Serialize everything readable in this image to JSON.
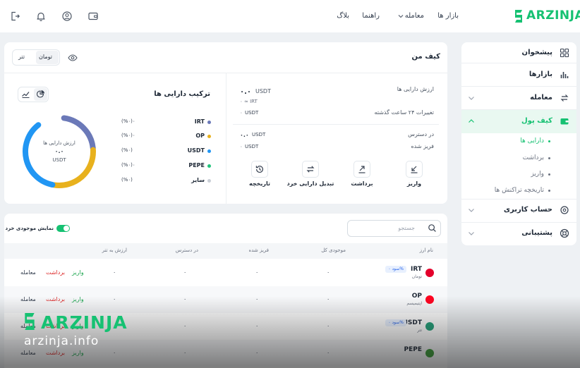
{
  "brand": {
    "name": "ARZINJA",
    "accent": "#16c172"
  },
  "header": {
    "nav": {
      "markets": "بازار ها",
      "trade": "معامله",
      "guide": "راهنما",
      "blog": "بلاگ"
    },
    "icons": [
      "wallet-icon",
      "user-icon",
      "bell-icon",
      "logout-icon"
    ]
  },
  "sidebar": {
    "items": [
      {
        "label": "پیشخوان",
        "icon": "grid-icon"
      },
      {
        "label": "بازارها",
        "icon": "bar-chart-icon"
      },
      {
        "label": "معامله",
        "icon": "exchange-icon"
      },
      {
        "label": "کیف پول",
        "icon": "wallet-icon"
      },
      {
        "label": "حساب کاربری",
        "icon": "settings-icon"
      },
      {
        "label": "پشتیبانی",
        "icon": "support-icon"
      }
    ],
    "wallet_sub": [
      "دارایی ها",
      "برداشت",
      "واریز",
      "تاریخچه تراکنش ها"
    ]
  },
  "wallet": {
    "title": "کیف من",
    "toggle": {
      "options": [
        "تومان",
        "تتر"
      ],
      "selected": "تومان"
    },
    "asset_value_label": "ارزش دارایی ها",
    "asset_value": "۰.۰",
    "asset_unit": "USDT",
    "irt_approx": "≈ IRT",
    "irt_value": "۰",
    "change_label": "تغییرات ۲۴ ساعت گذشته",
    "change_value": "۰",
    "change_unit": "USDT",
    "available_label": "در دسترس",
    "available_value": "۰.۰",
    "available_unit": "USDT",
    "frozen_label": "فریز شده",
    "frozen_value": "۰",
    "frozen_unit": "USDT",
    "actions": [
      "واریز",
      "برداشت",
      "تبدیل دارایی خرد",
      "تاریخچه"
    ]
  },
  "composition": {
    "title": "ترکیب دارایی ها",
    "center_label": "ارزش دارایی ها",
    "center_value": "۰.۰",
    "center_unit": "USDT",
    "legend": [
      {
        "name": "IRT",
        "pct": "(%۰)۰",
        "color": "#6b79b8"
      },
      {
        "name": "OP",
        "pct": "(%۰)۰",
        "color": "#e8b11d"
      },
      {
        "name": "USDT",
        "pct": "(%۰)",
        "color": "#2196f3"
      },
      {
        "name": "PEPE",
        "pct": "(%۰)۰",
        "color": "#22c47c"
      },
      {
        "name": "سایر",
        "pct": "(%۰)",
        "color": "#c9ced6"
      }
    ],
    "donut": [
      {
        "name": "IRT",
        "share": 0.22,
        "color": "#6b79b8"
      },
      {
        "name": "OP",
        "share": 0.29,
        "color": "#e8b11d"
      },
      {
        "name": "USDT",
        "share": 0.37,
        "color": "#2196f3"
      },
      {
        "name": "gap",
        "share": 0.12,
        "color": "#ffffff"
      }
    ]
  },
  "assets": {
    "search_placeholder": "جستجو",
    "small_balance_toggle": "نمایش موجودی خرد",
    "columns": [
      "نام ارز",
      "موجودی کل",
      "فریز شده",
      "در دسترس",
      "ارزش به تتر"
    ],
    "action_labels": {
      "deposit": "واریز",
      "withdraw": "برداشت",
      "trade": "معامله"
    },
    "rows": [
      {
        "symbol": "IRT",
        "name": "تومان",
        "badge": "سود ۰%",
        "total": "۰",
        "frozen": "۰",
        "available": "۰",
        "value": "۰"
      },
      {
        "symbol": "OP",
        "name": "اپتیمیسم",
        "badge": "",
        "total": "۰",
        "frozen": "۰",
        "available": "۰",
        "value": "۰"
      },
      {
        "symbol": "USDT",
        "name": "تتر",
        "badge": "سود ۰%",
        "total": "۰",
        "frozen": "۰",
        "available": "۰",
        "value": "۰"
      },
      {
        "symbol": "PEPE",
        "name": "",
        "badge": "",
        "total": "۰",
        "frozen": "۰",
        "available": "۰",
        "value": "۰"
      }
    ]
  },
  "watermark": {
    "brand": "ARZINJA",
    "url": "arzinja.info"
  }
}
